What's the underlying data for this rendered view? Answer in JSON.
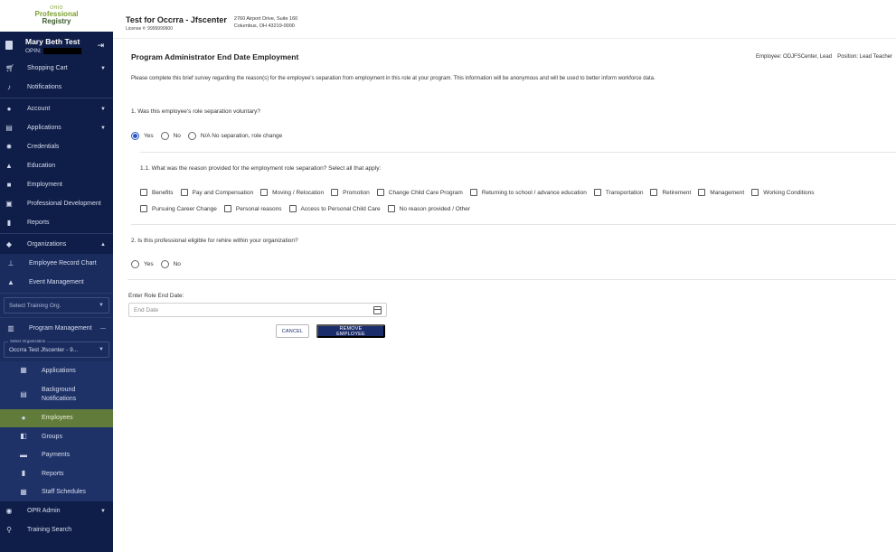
{
  "logo": {
    "line1": "OHIO",
    "line2": "Professional",
    "line3": "Registry"
  },
  "user": {
    "name": "Mary Beth Test",
    "opin_label": "OPIN:"
  },
  "sidebar": {
    "top_items": [
      {
        "label": "Shopping Cart",
        "icon": "cart-icon"
      },
      {
        "label": "Notifications",
        "icon": "bell-icon"
      }
    ],
    "main_items": [
      {
        "label": "Account",
        "icon": "person-icon"
      },
      {
        "label": "Applications",
        "icon": "applications-icon"
      },
      {
        "label": "Credentials",
        "icon": "credentials-icon"
      },
      {
        "label": "Education",
        "icon": "graduation-icon"
      },
      {
        "label": "Employment",
        "icon": "briefcase-icon"
      },
      {
        "label": "Professional Development",
        "icon": "development-icon"
      },
      {
        "label": "Reports",
        "icon": "reports-icon"
      }
    ],
    "organizations": {
      "label": "Organizations"
    },
    "org_sub": [
      {
        "label": "Employee Record Chart",
        "icon": "org-chart-icon"
      },
      {
        "label": "Event Management",
        "icon": "graduation-icon"
      }
    ],
    "select_training_org": "Select Training Org.",
    "program_management": "Program Management",
    "select_org_label": "Select Organization",
    "select_org_value": "Occrra Test Jfscenter - 9...",
    "prog_items": [
      {
        "label": "Applications",
        "icon": "grid-icon"
      },
      {
        "label": "Background Notifications",
        "icon": "id-card-icon"
      },
      {
        "label": "Employees",
        "icon": "person-icon"
      },
      {
        "label": "Groups",
        "icon": "groups-icon"
      },
      {
        "label": "Payments",
        "icon": "payments-icon"
      },
      {
        "label": "Reports",
        "icon": "reports-icon"
      },
      {
        "label": "Staff Schedules",
        "icon": "calendar-icon"
      }
    ],
    "bottom_items": [
      {
        "label": "OPR Admin",
        "icon": "eye-icon"
      },
      {
        "label": "Training Search",
        "icon": "search-icon"
      }
    ]
  },
  "header": {
    "org_name": "Test for Occrra - Jfscenter",
    "license": "License #: 9999999900",
    "address_line1": "2760 Airport Drive, Suite 160",
    "address_line2": "Columbus, OH 43219-0000"
  },
  "form": {
    "title": "Program Administrator End Date Employment",
    "employee": "Employee: ODJFSCenter, Lead",
    "position": "Position: Lead Teacher",
    "intro": "Please complete this brief survey regarding the reason(s) for the employee's separation from employment in this role at your program. This information will be anonymous and will be used to better inform workforce data.",
    "q1": "1. Was this employee's role separation voluntary?",
    "q1_options": [
      "Yes",
      "No",
      "N/A No separation, role change"
    ],
    "q1_1": "1.1. What was the reason provided for the employment role separation? Select all that apply:",
    "reasons_row1": [
      "Benefits",
      "Pay and Compensation",
      "Moving / Relocation",
      "Promotion",
      "Change Child Care Program",
      "Returning to school / advance education",
      "Transportation",
      "Retirement",
      "Management",
      "Working Conditions"
    ],
    "reasons_row2": [
      "Pursuing Career Change",
      "Personal reasons",
      "Access to Personal Child Care",
      "No reason provided / Other"
    ],
    "q2": "2. Is this professional eligible for rehire within your organization?",
    "q2_options": [
      "Yes",
      "No"
    ],
    "end_date_label": "Enter Role End Date:",
    "end_date_placeholder": "End Date",
    "cancel_label": "CANCEL",
    "remove_label": "REMOVE EMPLOYEE"
  }
}
